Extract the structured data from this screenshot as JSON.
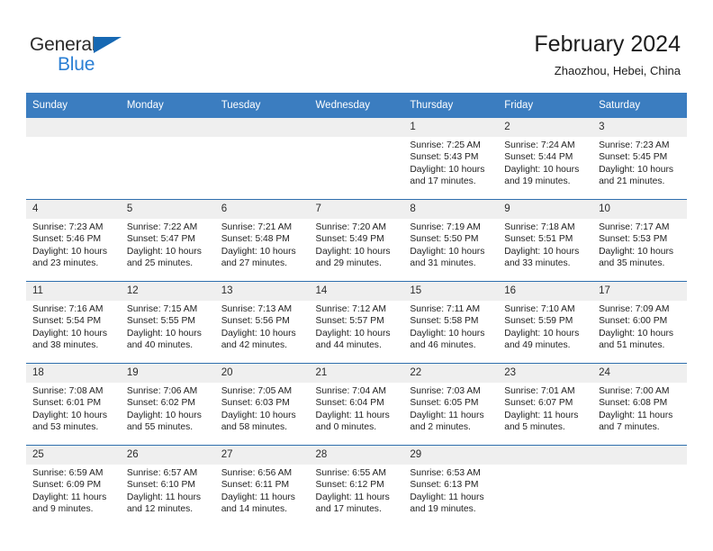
{
  "logo": {
    "word_top": "General",
    "word_bottom": "Blue",
    "triangle_color": "#1668b3",
    "blue_color": "#2a7fd4"
  },
  "header": {
    "title": "February 2024",
    "subtitle": "Zhaozhou, Hebei, China"
  },
  "theme": {
    "header_blue": "#3b7dc0",
    "row_divider_blue": "#2f6fae",
    "daynum_band": "#efefef"
  },
  "weekday_headers": [
    "Sunday",
    "Monday",
    "Tuesday",
    "Wednesday",
    "Thursday",
    "Friday",
    "Saturday"
  ],
  "weeks": [
    [
      {
        "day": "",
        "sunrise": "",
        "sunset": "",
        "daylight": "",
        "empty": true
      },
      {
        "day": "",
        "sunrise": "",
        "sunset": "",
        "daylight": "",
        "empty": true
      },
      {
        "day": "",
        "sunrise": "",
        "sunset": "",
        "daylight": "",
        "empty": true
      },
      {
        "day": "",
        "sunrise": "",
        "sunset": "",
        "daylight": "",
        "empty": true
      },
      {
        "day": "1",
        "sunrise": "Sunrise: 7:25 AM",
        "sunset": "Sunset: 5:43 PM",
        "daylight": "Daylight: 10 hours and 17 minutes.",
        "empty": false
      },
      {
        "day": "2",
        "sunrise": "Sunrise: 7:24 AM",
        "sunset": "Sunset: 5:44 PM",
        "daylight": "Daylight: 10 hours and 19 minutes.",
        "empty": false
      },
      {
        "day": "3",
        "sunrise": "Sunrise: 7:23 AM",
        "sunset": "Sunset: 5:45 PM",
        "daylight": "Daylight: 10 hours and 21 minutes.",
        "empty": false
      }
    ],
    [
      {
        "day": "4",
        "sunrise": "Sunrise: 7:23 AM",
        "sunset": "Sunset: 5:46 PM",
        "daylight": "Daylight: 10 hours and 23 minutes.",
        "empty": false
      },
      {
        "day": "5",
        "sunrise": "Sunrise: 7:22 AM",
        "sunset": "Sunset: 5:47 PM",
        "daylight": "Daylight: 10 hours and 25 minutes.",
        "empty": false
      },
      {
        "day": "6",
        "sunrise": "Sunrise: 7:21 AM",
        "sunset": "Sunset: 5:48 PM",
        "daylight": "Daylight: 10 hours and 27 minutes.",
        "empty": false
      },
      {
        "day": "7",
        "sunrise": "Sunrise: 7:20 AM",
        "sunset": "Sunset: 5:49 PM",
        "daylight": "Daylight: 10 hours and 29 minutes.",
        "empty": false
      },
      {
        "day": "8",
        "sunrise": "Sunrise: 7:19 AM",
        "sunset": "Sunset: 5:50 PM",
        "daylight": "Daylight: 10 hours and 31 minutes.",
        "empty": false
      },
      {
        "day": "9",
        "sunrise": "Sunrise: 7:18 AM",
        "sunset": "Sunset: 5:51 PM",
        "daylight": "Daylight: 10 hours and 33 minutes.",
        "empty": false
      },
      {
        "day": "10",
        "sunrise": "Sunrise: 7:17 AM",
        "sunset": "Sunset: 5:53 PM",
        "daylight": "Daylight: 10 hours and 35 minutes.",
        "empty": false
      }
    ],
    [
      {
        "day": "11",
        "sunrise": "Sunrise: 7:16 AM",
        "sunset": "Sunset: 5:54 PM",
        "daylight": "Daylight: 10 hours and 38 minutes.",
        "empty": false
      },
      {
        "day": "12",
        "sunrise": "Sunrise: 7:15 AM",
        "sunset": "Sunset: 5:55 PM",
        "daylight": "Daylight: 10 hours and 40 minutes.",
        "empty": false
      },
      {
        "day": "13",
        "sunrise": "Sunrise: 7:13 AM",
        "sunset": "Sunset: 5:56 PM",
        "daylight": "Daylight: 10 hours and 42 minutes.",
        "empty": false
      },
      {
        "day": "14",
        "sunrise": "Sunrise: 7:12 AM",
        "sunset": "Sunset: 5:57 PM",
        "daylight": "Daylight: 10 hours and 44 minutes.",
        "empty": false
      },
      {
        "day": "15",
        "sunrise": "Sunrise: 7:11 AM",
        "sunset": "Sunset: 5:58 PM",
        "daylight": "Daylight: 10 hours and 46 minutes.",
        "empty": false
      },
      {
        "day": "16",
        "sunrise": "Sunrise: 7:10 AM",
        "sunset": "Sunset: 5:59 PM",
        "daylight": "Daylight: 10 hours and 49 minutes.",
        "empty": false
      },
      {
        "day": "17",
        "sunrise": "Sunrise: 7:09 AM",
        "sunset": "Sunset: 6:00 PM",
        "daylight": "Daylight: 10 hours and 51 minutes.",
        "empty": false
      }
    ],
    [
      {
        "day": "18",
        "sunrise": "Sunrise: 7:08 AM",
        "sunset": "Sunset: 6:01 PM",
        "daylight": "Daylight: 10 hours and 53 minutes.",
        "empty": false
      },
      {
        "day": "19",
        "sunrise": "Sunrise: 7:06 AM",
        "sunset": "Sunset: 6:02 PM",
        "daylight": "Daylight: 10 hours and 55 minutes.",
        "empty": false
      },
      {
        "day": "20",
        "sunrise": "Sunrise: 7:05 AM",
        "sunset": "Sunset: 6:03 PM",
        "daylight": "Daylight: 10 hours and 58 minutes.",
        "empty": false
      },
      {
        "day": "21",
        "sunrise": "Sunrise: 7:04 AM",
        "sunset": "Sunset: 6:04 PM",
        "daylight": "Daylight: 11 hours and 0 minutes.",
        "empty": false
      },
      {
        "day": "22",
        "sunrise": "Sunrise: 7:03 AM",
        "sunset": "Sunset: 6:05 PM",
        "daylight": "Daylight: 11 hours and 2 minutes.",
        "empty": false
      },
      {
        "day": "23",
        "sunrise": "Sunrise: 7:01 AM",
        "sunset": "Sunset: 6:07 PM",
        "daylight": "Daylight: 11 hours and 5 minutes.",
        "empty": false
      },
      {
        "day": "24",
        "sunrise": "Sunrise: 7:00 AM",
        "sunset": "Sunset: 6:08 PM",
        "daylight": "Daylight: 11 hours and 7 minutes.",
        "empty": false
      }
    ],
    [
      {
        "day": "25",
        "sunrise": "Sunrise: 6:59 AM",
        "sunset": "Sunset: 6:09 PM",
        "daylight": "Daylight: 11 hours and 9 minutes.",
        "empty": false
      },
      {
        "day": "26",
        "sunrise": "Sunrise: 6:57 AM",
        "sunset": "Sunset: 6:10 PM",
        "daylight": "Daylight: 11 hours and 12 minutes.",
        "empty": false
      },
      {
        "day": "27",
        "sunrise": "Sunrise: 6:56 AM",
        "sunset": "Sunset: 6:11 PM",
        "daylight": "Daylight: 11 hours and 14 minutes.",
        "empty": false
      },
      {
        "day": "28",
        "sunrise": "Sunrise: 6:55 AM",
        "sunset": "Sunset: 6:12 PM",
        "daylight": "Daylight: 11 hours and 17 minutes.",
        "empty": false
      },
      {
        "day": "29",
        "sunrise": "Sunrise: 6:53 AM",
        "sunset": "Sunset: 6:13 PM",
        "daylight": "Daylight: 11 hours and 19 minutes.",
        "empty": false
      },
      {
        "day": "",
        "sunrise": "",
        "sunset": "",
        "daylight": "",
        "empty": true
      },
      {
        "day": "",
        "sunrise": "",
        "sunset": "",
        "daylight": "",
        "empty": true
      }
    ]
  ]
}
